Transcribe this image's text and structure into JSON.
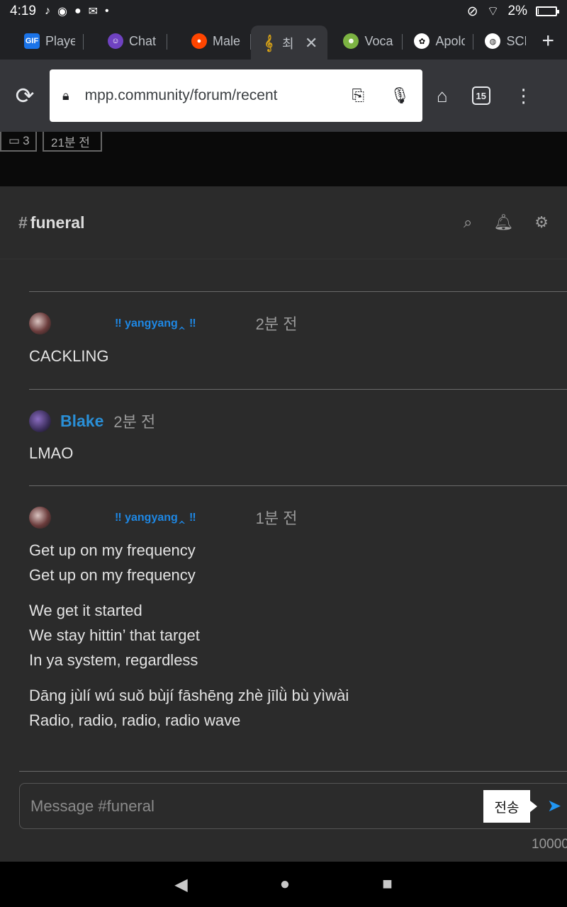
{
  "status_bar": {
    "time": "4:19",
    "battery": "2%",
    "battery_level": 0.02
  },
  "tabs": [
    {
      "label": "Playe",
      "icon": "GIF",
      "color": "#1a73e8"
    },
    {
      "label": "Chat",
      "icon": "",
      "color": "#6f42c1"
    },
    {
      "label": "Male",
      "icon": "",
      "color": "#ff4500"
    },
    {
      "label": "최",
      "icon": "",
      "color": "#d4a017",
      "active": true
    },
    {
      "label": "Voca",
      "icon": "",
      "color": "#7cb342"
    },
    {
      "label": "Apolo",
      "icon": "",
      "color": "#444444"
    },
    {
      "label": "SCP",
      "icon": "",
      "color": "#666666"
    }
  ],
  "toolbar": {
    "url": "mpp.community/forum/recent",
    "tab_count": "15"
  },
  "behind_page": {
    "comment_count": "3",
    "timestamp": "21분 전"
  },
  "channel": {
    "hash": "#",
    "name": "funeral"
  },
  "messages": [
    {
      "author": "‼ yangyang‸ ‼",
      "time": "2분 전",
      "lines": [
        [
          "CACKLING"
        ]
      ]
    },
    {
      "author": "Blake",
      "time": "2분 전",
      "lines": [
        [
          "LMAO"
        ]
      ]
    },
    {
      "author": "‼ yangyang‸ ‼",
      "time": "1분 전",
      "lines": [
        [
          "Get up on my frequency",
          "Get up on my frequency"
        ],
        [
          "We get it started",
          "We stay hittin’ that target",
          "In ya system, regardless"
        ],
        [
          "Dāng jùlí wú suǒ bùjí fāshēng zhè jīlǜ bù yìwài",
          "Radio, radio, radio, radio wave"
        ]
      ]
    }
  ],
  "composer": {
    "placeholder": "Message #funeral",
    "tooltip": "전송",
    "counter": "10000"
  },
  "colors": {
    "accent": "#2a8fd6",
    "panel_bg": "#2b2b2b"
  }
}
